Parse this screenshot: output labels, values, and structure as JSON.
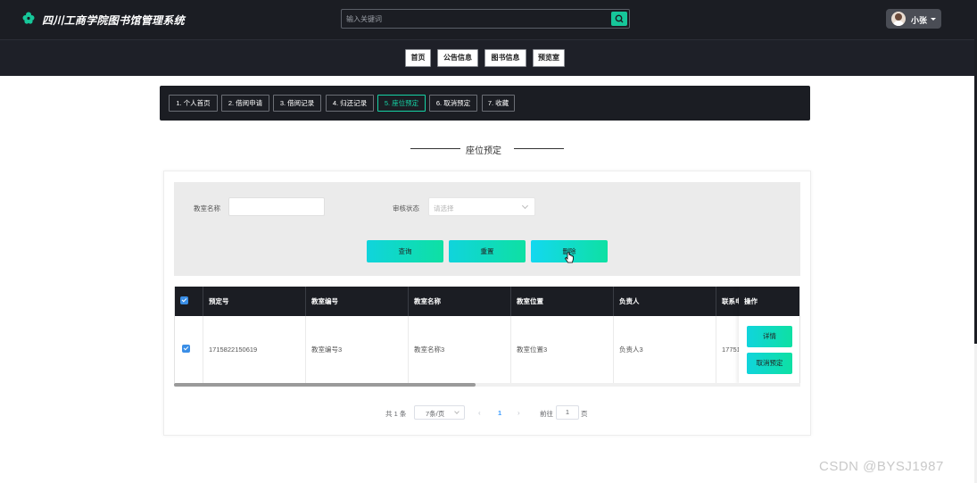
{
  "header": {
    "title": "四川工商学院图书馆管理系统",
    "search_placeholder": "输入关键词",
    "user_name": "小张"
  },
  "nav": {
    "items": [
      "首页",
      "公告信息",
      "图书信息",
      "预览室"
    ]
  },
  "submenu": {
    "items": [
      "1. 个人首页",
      "2. 借阅申请",
      "3. 借阅记录",
      "4. 归还记录",
      "5. 座位预定",
      "6. 取消预定",
      "7. 收藏"
    ],
    "active_index": 4
  },
  "section": {
    "title": "座位预定"
  },
  "filters": {
    "classroom_name_label": "教室名称",
    "audit_status_label": "审核状态",
    "audit_status_placeholder": "请选择"
  },
  "actions": {
    "query": "查询",
    "reset": "重置",
    "delete": "删除"
  },
  "table": {
    "columns": [
      "预定号",
      "教室编号",
      "教室名称",
      "教室位置",
      "负责人",
      "联系电"
    ],
    "ops_header": "操作",
    "rows": [
      {
        "booking_no": "1715822150619",
        "classroom_no": "教室编号3",
        "classroom_name": "教室名称3",
        "classroom_location": "教室位置3",
        "manager": "负责人3",
        "phone": "17751"
      }
    ],
    "row_actions": {
      "detail": "详情",
      "cancel": "取消预定"
    }
  },
  "pagination": {
    "total": "共 1 条",
    "page_size": "7条/页",
    "current_page": "1",
    "goto_label": "前往",
    "goto_value": "1",
    "page_unit": "页",
    "prev": "‹",
    "next": "›"
  },
  "watermark": "CSDN @BYSJ1987",
  "colors": {
    "dark": "#1b1d23",
    "accent": "#16d3a5",
    "button_gradient_start": "#10d4dc",
    "button_gradient_end": "#0ee0a3"
  }
}
